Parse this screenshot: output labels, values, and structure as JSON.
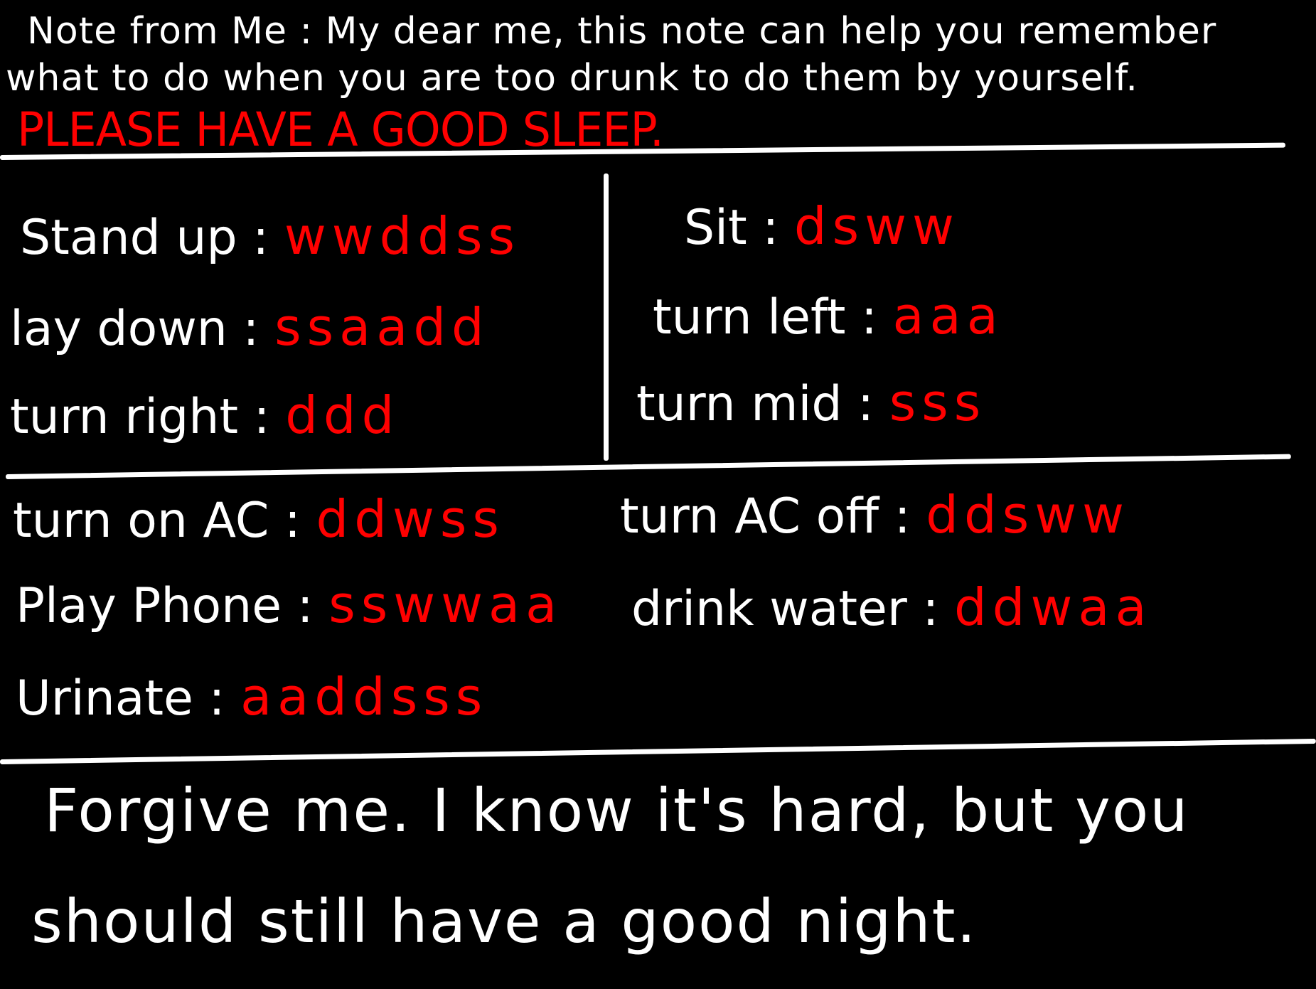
{
  "header": {
    "intro_line_1": "Note from Me : My dear me, this note can help you remember",
    "intro_line_2": "what to do when you are too drunk to do them by yourself.",
    "warning": "PLEASE HAVE A GOOD SLEEP."
  },
  "commands": {
    "stand_up": {
      "label": "Stand up",
      "code": "wwddss"
    },
    "lay_down": {
      "label": "lay down",
      "code": "ssaadd"
    },
    "turn_right": {
      "label": "turn right",
      "code": "ddd"
    },
    "sit": {
      "label": "Sit",
      "code": "dsww"
    },
    "turn_left": {
      "label": "turn left",
      "code": "aaa"
    },
    "turn_mid": {
      "label": "turn mid",
      "code": "sss"
    },
    "turn_on_ac": {
      "label": "turn on AC",
      "code": "ddwss"
    },
    "play_phone": {
      "label": "Play Phone",
      "code": "sswwaa"
    },
    "urinate": {
      "label": "Urinate",
      "code": "aaddsss"
    },
    "turn_ac_off": {
      "label": "turn AC off",
      "code": "ddsww"
    },
    "drink_water": {
      "label": "drink water",
      "code": "ddwaa"
    }
  },
  "separator": ":",
  "closing": {
    "line_1": "Forgive me. I know it's hard, but you",
    "line_2": "should still have a good night."
  },
  "colors": {
    "background": "#000000",
    "text": "#ffffff",
    "code": "#ff0000"
  }
}
